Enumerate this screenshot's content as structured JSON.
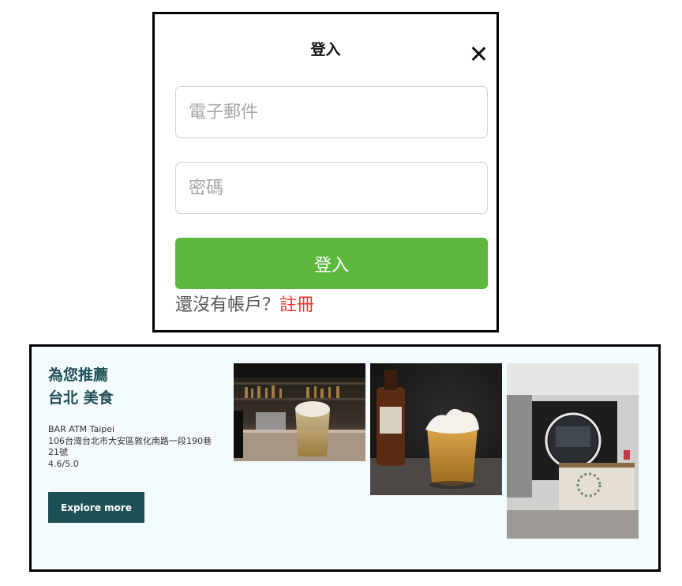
{
  "login_modal": {
    "title": "登入",
    "email_placeholder": "電子郵件",
    "password_placeholder": "密碼",
    "login_button": "登入",
    "signup_prompt": "還沒有帳戶？",
    "signup_link": "註冊",
    "close_icon": "close-icon",
    "colors": {
      "login_button": "#5db83e",
      "signup_link": "#e03c31"
    }
  },
  "recommendation": {
    "title_line1": "為您推薦",
    "title_line2": "台北 美食",
    "restaurant_name": "BAR ATM Taipei",
    "address_line1": "106台灣台北市大安區敦化南路一段190巷",
    "address_line2": "21號",
    "rating": "4.6/5.0",
    "explore_button": "Explore more",
    "colors": {
      "title": "#1f4f56",
      "button": "#1e5157",
      "background": "#f4fbff"
    },
    "photos": [
      "bar-counter-photo",
      "cocktail-glass-photo",
      "bar-interior-photo"
    ]
  }
}
